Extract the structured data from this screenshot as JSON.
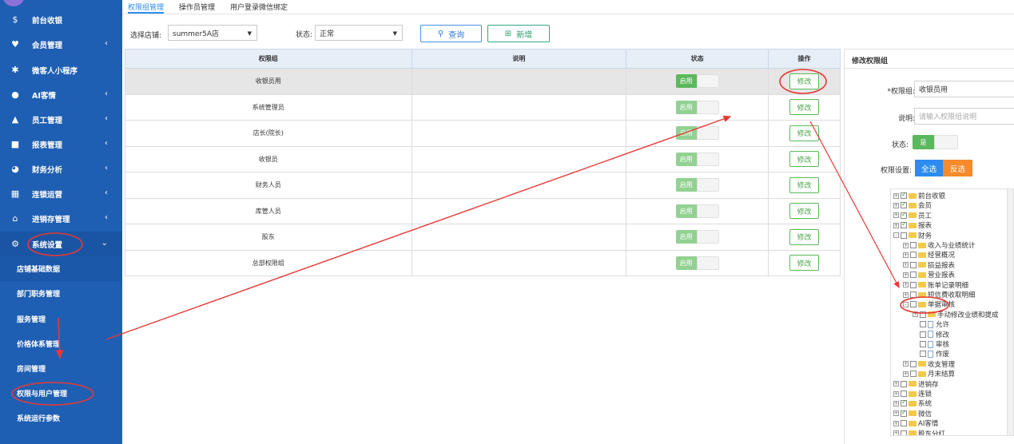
{
  "sidebar": {
    "items": [
      {
        "label": "前台收银",
        "icon": "cash-icon",
        "has_chevron": false
      },
      {
        "label": "会员管理",
        "icon": "heart-icon",
        "has_chevron": true
      },
      {
        "label": "微客人小程序",
        "icon": "grid-icon",
        "has_chevron": false
      },
      {
        "label": "AI客情",
        "icon": "user-icon",
        "has_chevron": true
      },
      {
        "label": "员工管理",
        "icon": "person-icon",
        "has_chevron": true
      },
      {
        "label": "报表管理",
        "icon": "monitor-icon",
        "has_chevron": true
      },
      {
        "label": "财务分析",
        "icon": "pie-icon",
        "has_chevron": true
      },
      {
        "label": "连锁运营",
        "icon": "building-icon",
        "has_chevron": true
      },
      {
        "label": "进销存管理",
        "icon": "home-icon",
        "has_chevron": true
      },
      {
        "label": "系统设置",
        "icon": "gear-icon",
        "has_chevron": true
      }
    ],
    "subitems": [
      "店铺基础数据",
      "部门职务管理",
      "服务管理",
      "价格体系管理",
      "房间管理",
      "权限与用户管理",
      "系统运行参数"
    ]
  },
  "tabs": [
    "权限组管理",
    "操作员管理",
    "用户登录微信绑定"
  ],
  "filters": {
    "store_label": "选择店铺:",
    "store_value": "summer5A店",
    "status_label": "状态:",
    "status_value": "正常",
    "query_label": "查询",
    "add_label": "新增"
  },
  "table": {
    "headers": [
      "权限组",
      "说明",
      "状态",
      "操作"
    ],
    "rows": [
      {
        "name": "收银员用",
        "desc": "",
        "status": "启用",
        "action": "修改"
      },
      {
        "name": "系统管理员",
        "desc": "",
        "status": "启用",
        "action": "修改"
      },
      {
        "name": "店长(院长)",
        "desc": "",
        "status": "启用",
        "action": "修改"
      },
      {
        "name": "收银员",
        "desc": "",
        "status": "启用",
        "action": "修改"
      },
      {
        "name": "财务人员",
        "desc": "",
        "status": "启用",
        "action": "修改"
      },
      {
        "name": "库管人员",
        "desc": "",
        "status": "启用",
        "action": "修改"
      },
      {
        "name": "股东",
        "desc": "",
        "status": "启用",
        "action": "修改"
      },
      {
        "name": "总部权限组",
        "desc": "",
        "status": "启用",
        "action": "修改"
      }
    ]
  },
  "panel": {
    "title": "修改权限组",
    "group_label": "*权限组:",
    "group_value": "收银员用",
    "desc_label": "说明:",
    "desc_placeholder": "请输入权限组说明",
    "status_label": "状态:",
    "status_value": "是",
    "perm_label": "权限设置:",
    "select_all": "全选",
    "invert": "反选",
    "tree": [
      {
        "level": 0,
        "label": "前台收银",
        "checked": true,
        "type": "folder",
        "pm": "+"
      },
      {
        "level": 0,
        "label": "会员",
        "checked": true,
        "type": "folder",
        "pm": "+"
      },
      {
        "level": 0,
        "label": "员工",
        "checked": true,
        "type": "folder",
        "pm": "+"
      },
      {
        "level": 0,
        "label": "报表",
        "checked": true,
        "type": "folder",
        "pm": "+"
      },
      {
        "level": 0,
        "label": "财务",
        "checked": false,
        "type": "folder",
        "pm": "-"
      },
      {
        "level": 1,
        "label": "收入与业绩统计",
        "checked": false,
        "type": "folder",
        "pm": "+"
      },
      {
        "level": 1,
        "label": "经营概况",
        "checked": false,
        "type": "folder",
        "pm": "+"
      },
      {
        "level": 1,
        "label": "损益报表",
        "checked": false,
        "type": "folder",
        "pm": "+"
      },
      {
        "level": 1,
        "label": "营业报表",
        "checked": false,
        "type": "folder",
        "pm": "+"
      },
      {
        "level": 1,
        "label": "账单记录明细",
        "checked": false,
        "type": "folder",
        "pm": "+"
      },
      {
        "level": 1,
        "label": "短信费收取明细",
        "checked": false,
        "type": "folder",
        "pm": "+"
      },
      {
        "level": 1,
        "label": "单据审核",
        "checked": false,
        "type": "folder",
        "pm": "-"
      },
      {
        "level": 2,
        "label": "手动修改业绩和提成",
        "checked": false,
        "type": "folder",
        "pm": "+"
      },
      {
        "level": 2,
        "label": "允许",
        "checked": false,
        "type": "file",
        "pm": ""
      },
      {
        "level": 2,
        "label": "修改",
        "checked": false,
        "type": "file",
        "pm": ""
      },
      {
        "level": 2,
        "label": "审核",
        "checked": false,
        "type": "file",
        "pm": ""
      },
      {
        "level": 2,
        "label": "作废",
        "checked": false,
        "type": "file",
        "pm": ""
      },
      {
        "level": 1,
        "label": "收支管理",
        "checked": false,
        "type": "folder",
        "pm": "+"
      },
      {
        "level": 1,
        "label": "月末结算",
        "checked": false,
        "type": "folder",
        "pm": "+"
      },
      {
        "level": 0,
        "label": "进销存",
        "checked": false,
        "type": "folder",
        "pm": "+"
      },
      {
        "level": 0,
        "label": "连锁",
        "checked": false,
        "type": "folder",
        "pm": "+"
      },
      {
        "level": 0,
        "label": "系统",
        "checked": true,
        "type": "folder",
        "pm": "+"
      },
      {
        "level": 0,
        "label": "微信",
        "checked": true,
        "type": "folder",
        "pm": "+"
      },
      {
        "level": 0,
        "label": "AI客情",
        "checked": false,
        "type": "folder",
        "pm": "+"
      },
      {
        "level": 0,
        "label": "股东分红",
        "checked": false,
        "type": "folder",
        "pm": "+"
      }
    ]
  },
  "colors": {
    "sidebar": "#1e5fb3",
    "accent": "#2d8cf0",
    "green": "#5cb85c",
    "orange": "#f58b2a",
    "annotation": "#e53935"
  }
}
